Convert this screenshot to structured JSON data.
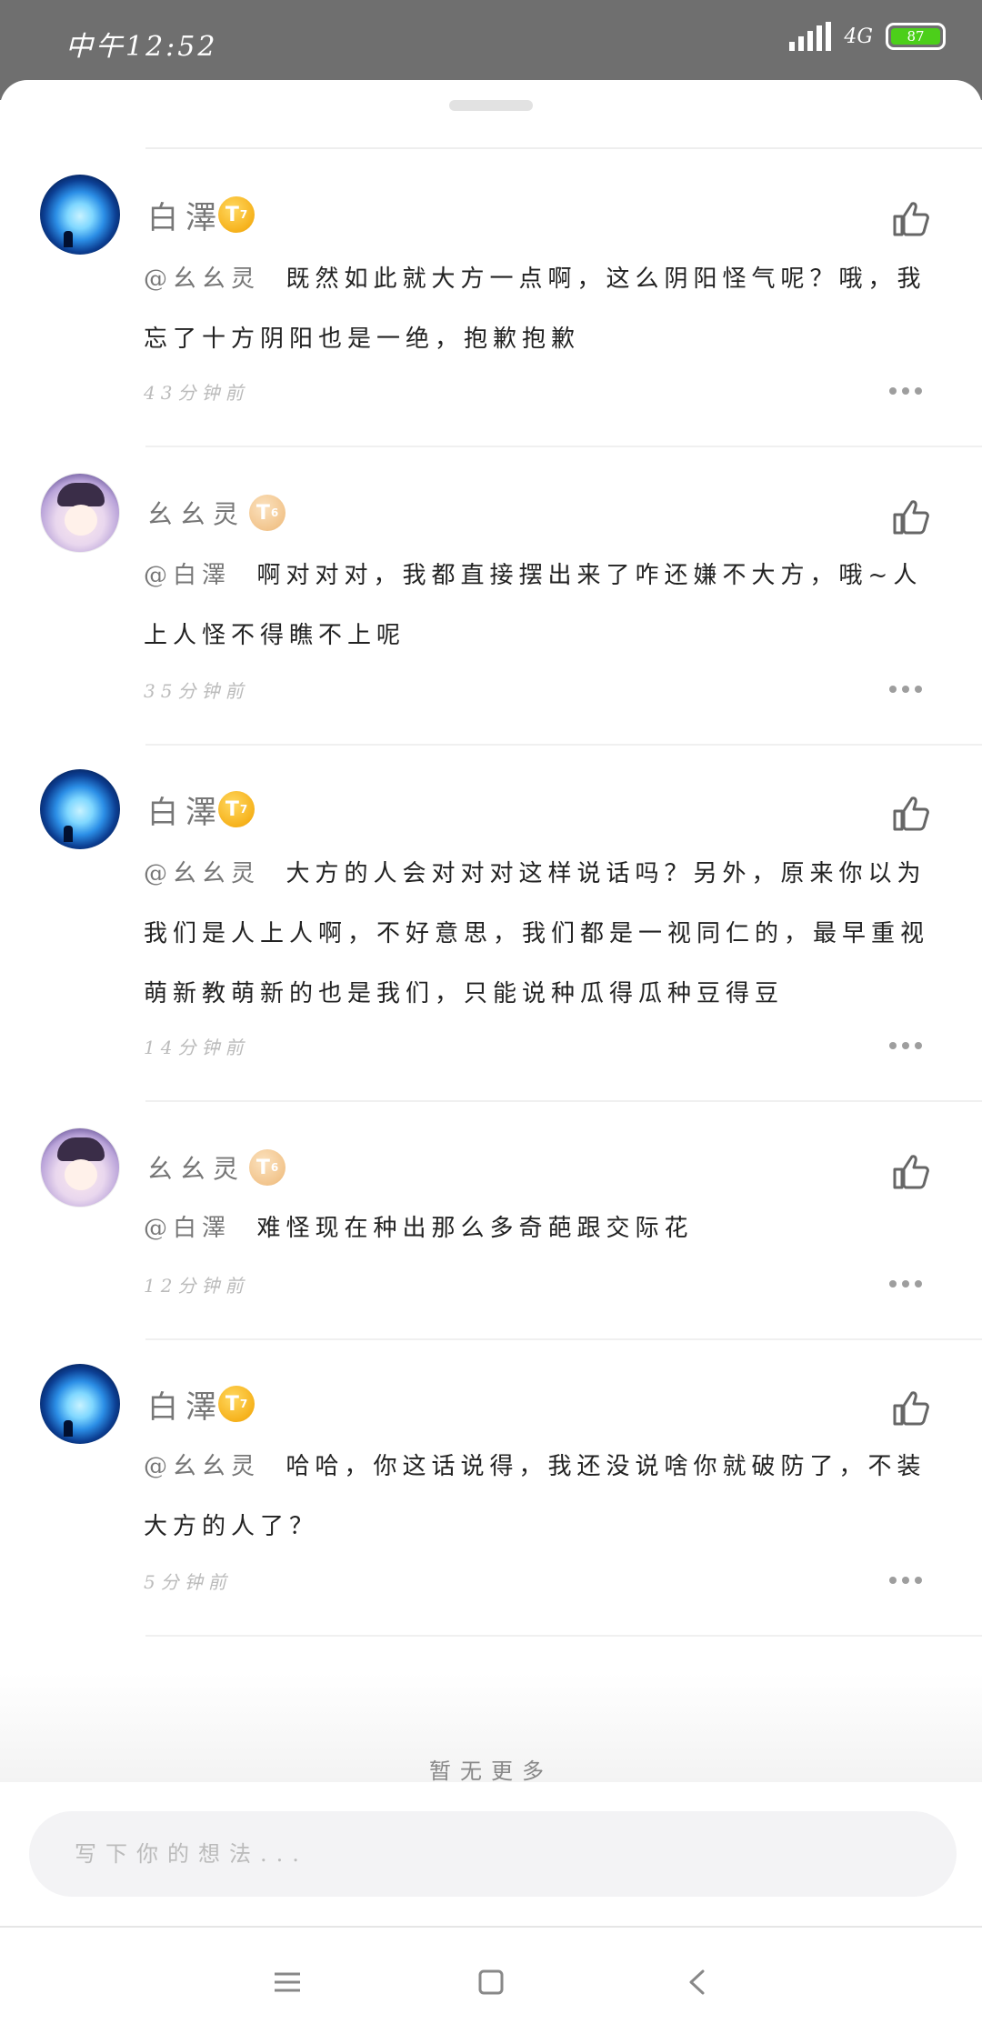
{
  "status_bar": {
    "time": "中午12:52",
    "network": "4G",
    "battery": "87"
  },
  "comments": [
    {
      "username": "白澤",
      "level": "7",
      "mention": "@幺幺灵",
      "text": "既然如此就大方一点啊，这么阴阳怪气呢？哦，我忘了十方阴阳也是一绝，抱歉抱歉",
      "time": "43分钟前"
    },
    {
      "username": "幺幺灵",
      "level": "6",
      "mention": "@白澤",
      "text": "啊对对对，我都直接摆出来了咋还嫌不大方，哦~人上人怪不得瞧不上呢",
      "time": "35分钟前"
    },
    {
      "username": "白澤",
      "level": "7",
      "mention": "@幺幺灵",
      "text": "大方的人会对对对这样说话吗？另外，原来你以为我们是人上人啊，不好意思，我们都是一视同仁的，最早重视萌新教萌新的也是我们，只能说种瓜得瓜种豆得豆",
      "time": "14分钟前"
    },
    {
      "username": "幺幺灵",
      "level": "6",
      "mention": "@白澤",
      "text": "难怪现在种出那么多奇葩跟交际花",
      "time": "12分钟前"
    },
    {
      "username": "白澤",
      "level": "7",
      "mention": "@幺幺灵",
      "text": "哈哈，你这话说得，我还没说啥你就破防了，不装大方的人了？",
      "time": "5分钟前"
    }
  ],
  "footer": {
    "no_more": "暂无更多",
    "input_placeholder": "写下你的想法..."
  }
}
